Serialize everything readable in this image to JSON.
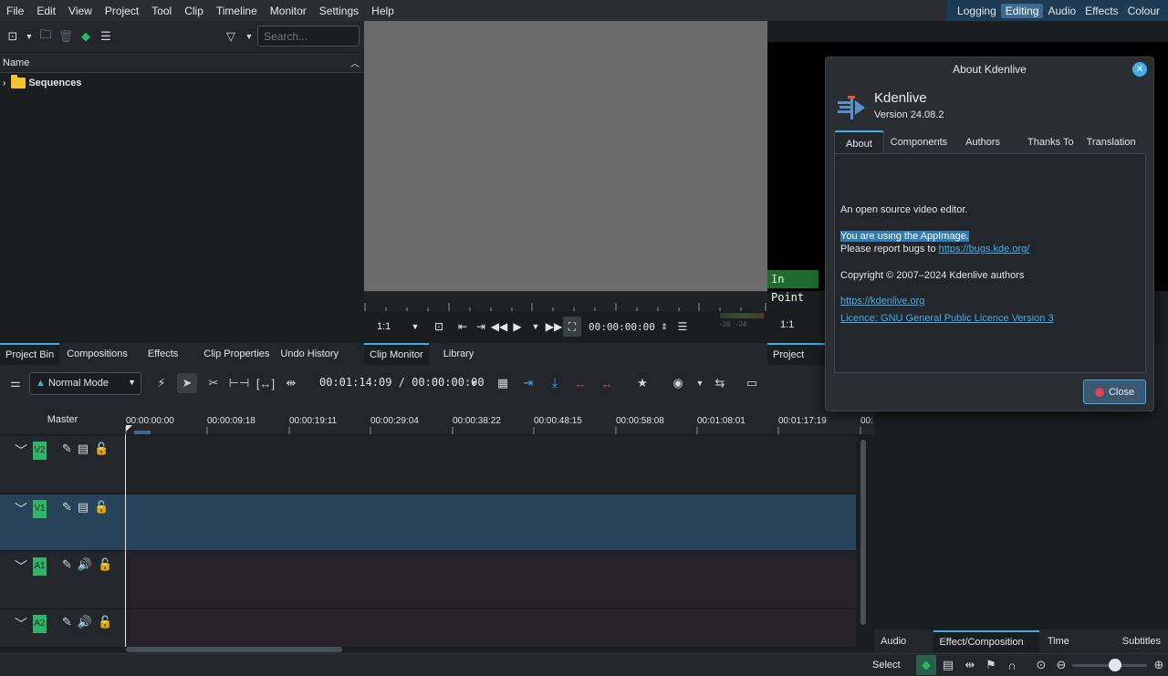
{
  "menu": [
    "File",
    "Edit",
    "View",
    "Project",
    "Tool",
    "Clip",
    "Timeline",
    "Monitor",
    "Settings",
    "Help"
  ],
  "layouts": {
    "items": [
      "Logging",
      "Editing",
      "Audio",
      "Effects",
      "Colour"
    ],
    "active": "Editing"
  },
  "bin": {
    "search_placeholder": "Search...",
    "column_header": "Name",
    "rows": [
      {
        "label": "Sequences"
      }
    ]
  },
  "left_tabs": [
    "Project Bin",
    "Compositions",
    "Effects",
    "Clip Properties",
    "Undo History"
  ],
  "clip_monitor": {
    "zoom": "1:1",
    "timecode": "00:00:00:00",
    "tabs": [
      "Clip Monitor",
      "Library"
    ]
  },
  "project_monitor": {
    "zoom": "1:1",
    "in_point_label": "In Point",
    "tab": "Project Mon",
    "meter_labels": [
      "-36",
      "-24"
    ]
  },
  "timeline_toolbar": {
    "mode": "Normal Mode",
    "timecode": "00:01:14:09 / 00:00:00:00"
  },
  "timeline": {
    "master_label": "Master",
    "ruler_ticks": [
      "00:00:00:00",
      "00:00:09:18",
      "00:00:19:11",
      "00:00:29:04",
      "00:00:38:22",
      "00:00:48:15",
      "00:00:58:08",
      "00:01:08:01",
      "00:01:17:19",
      "00:"
    ],
    "tracks": [
      {
        "label": "V2",
        "type": "video"
      },
      {
        "label": "V1",
        "type": "video"
      },
      {
        "label": "A1",
        "type": "audio"
      },
      {
        "label": "A2",
        "type": "audio"
      }
    ]
  },
  "right_tabs": [
    "Audio Mi...",
    "Effect/Composition ...",
    "Time Rema...",
    "Subtitles"
  ],
  "status": {
    "mode": "Select"
  },
  "about": {
    "title": "About Kdenlive",
    "app_name": "Kdenlive",
    "version": "Version 24.08.2",
    "tabs": [
      "About",
      "Components",
      "Authors",
      "Thanks To",
      "Translation"
    ],
    "description": "An open source video editor.",
    "appimage_note": "You are using the AppImage.",
    "report_prefix": "Please report bugs to ",
    "bugs_url": "https://bugs.kde.org/",
    "copyright": "Copyright © 2007–2024 Kdenlive authors",
    "homepage": "https://kdenlive.org",
    "licence": "Licence: GNU General Public Licence Version 3",
    "close_label": "Close"
  },
  "colors": {
    "accent": "#3daee9",
    "track_label": "#2fb468",
    "in_point": "#1d6b2e"
  }
}
